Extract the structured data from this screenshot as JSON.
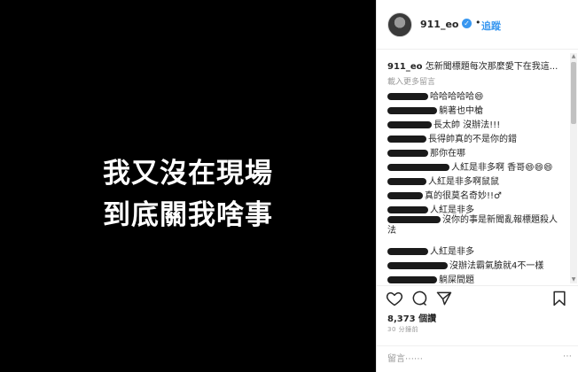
{
  "post_image": {
    "line1": "我又沒在現場",
    "line2": "到底關我啥事"
  },
  "header": {
    "username": "911_eo",
    "dot": "•",
    "follow_label": "追蹤"
  },
  "caption": {
    "username": "911_eo",
    "text": "怎新聞標題每次那麼愛下在我這..."
  },
  "load_more_label": "載入更多留言",
  "comments": [
    {
      "text": "哈哈哈哈哈😄"
    },
    {
      "text": "躺著也中槍"
    },
    {
      "text": "長太帥 沒辦法!!!"
    },
    {
      "text": "長得帥真的不是你的錯"
    },
    {
      "text": "那你在哪"
    },
    {
      "text": "人紅是非多啊 香哥😄😄😄"
    },
    {
      "text": "人紅是非多啊鼠鼠"
    },
    {
      "text": "真的很莫名奇妙!!♂"
    },
    {
      "text": "人紅是非多"
    },
    {
      "text": "沒你的事是新聞亂報標題殺人法"
    },
    {
      "text": "人紅是非多"
    },
    {
      "text": "沒辦法霸氣臉就4不一樣"
    },
    {
      "text": "躺屎間題"
    }
  ],
  "likes": {
    "count": "8,373",
    "unit": "個讚"
  },
  "timestamp": "30 分鐘前",
  "add_comment": {
    "placeholder": "留言⋯⋯",
    "more": "⋯"
  },
  "icons": {
    "like": "heart-icon",
    "comment": "comment-icon",
    "share": "share-icon",
    "save": "bookmark-icon",
    "verified": "verified-badge-icon"
  },
  "colors": {
    "accent": "#3897f0",
    "photo_bg": "#000000"
  }
}
